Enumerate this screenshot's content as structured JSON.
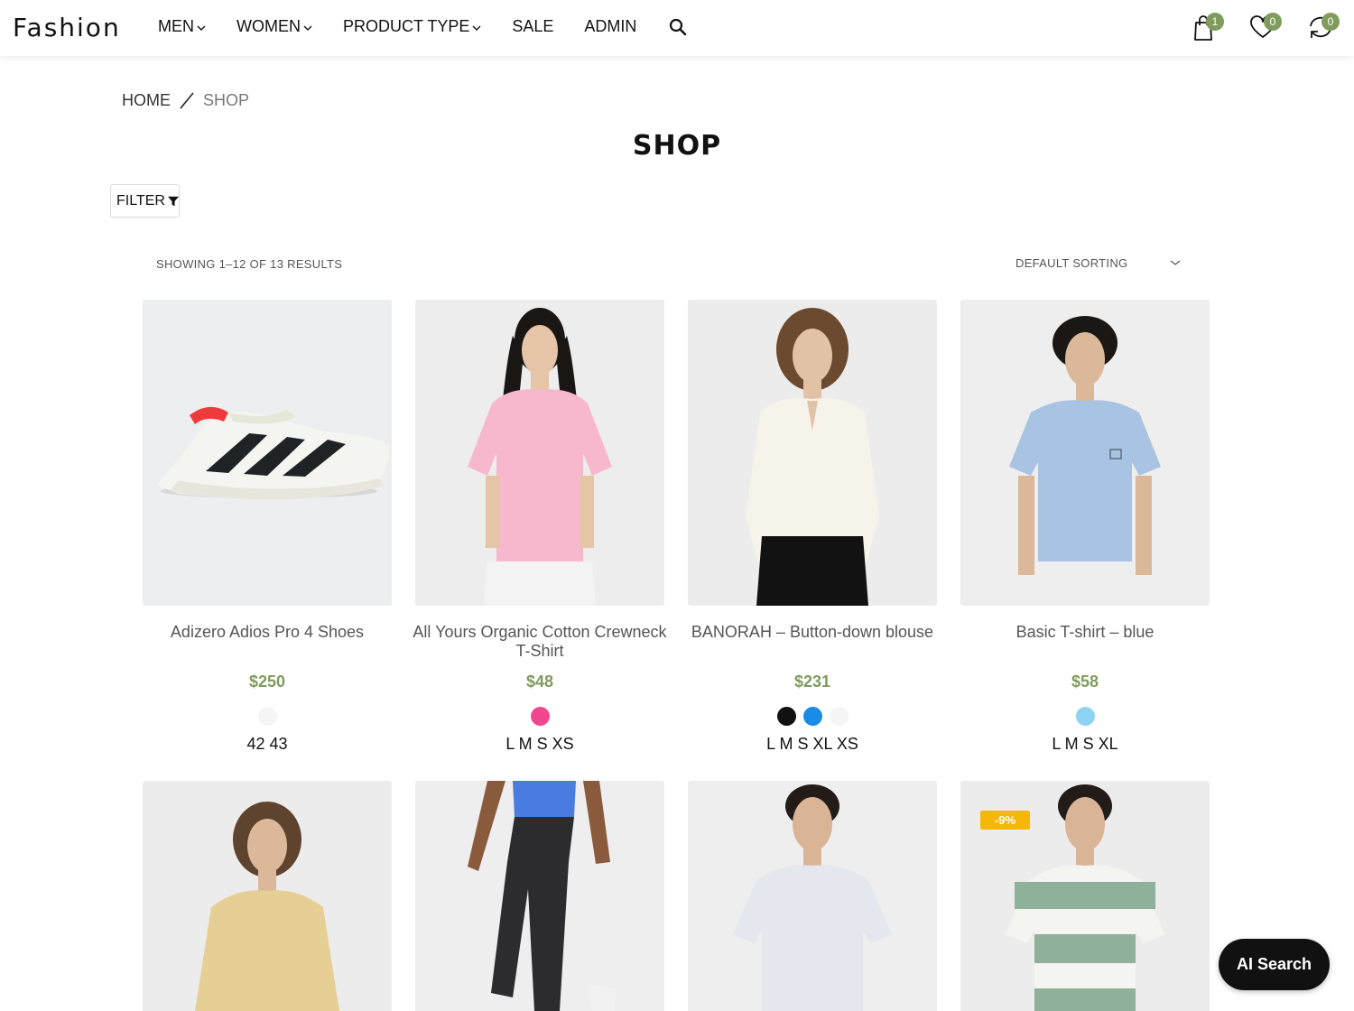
{
  "header": {
    "logo": "Fashion",
    "nav": [
      {
        "label": "MEN",
        "dropdown": true
      },
      {
        "label": "WOMEN",
        "dropdown": true
      },
      {
        "label": "PRODUCT TYPE",
        "dropdown": true
      },
      {
        "label": "SALE",
        "dropdown": false
      },
      {
        "label": "ADMIN",
        "dropdown": false
      }
    ],
    "cart_count": "1",
    "wishlist_count": "0",
    "compare_count": "0",
    "badge_color": "#7f9c5d"
  },
  "breadcrumb": {
    "home": "HOME",
    "current": "SHOP"
  },
  "page_title": "SHOP",
  "filter_label": "FILTER",
  "result_count": "SHOWING 1–12 OF 13 RESULTS",
  "sorting": "DEFAULT SORTING",
  "products": [
    {
      "name": "Adizero Adios Pro 4 Shoes",
      "price": "$250",
      "swatches": [
        "#f5f5f5"
      ],
      "sizes": "42 43",
      "image": "sneaker"
    },
    {
      "name": "All Yours Organic Cotton Crewneck T-Shirt",
      "price": "$48",
      "swatches": [
        "#f2478e"
      ],
      "sizes": "L M S XS",
      "image": "pink-tshirt-woman"
    },
    {
      "name": "BANORAH – Button-down blouse",
      "price": "$231",
      "swatches": [
        "#111111",
        "#1c8be6",
        "#f5f5f5"
      ],
      "sizes": "L M S XL XS",
      "image": "white-blouse-woman"
    },
    {
      "name": "Basic T-shirt – blue",
      "price": "$58",
      "swatches": [
        "#8fd3f4"
      ],
      "sizes": "L M S XL",
      "image": "blue-tshirt-man"
    },
    {
      "name": "",
      "price": "",
      "image": "yellow-blouse-woman"
    },
    {
      "name": "",
      "price": "",
      "image": "black-joggers"
    },
    {
      "name": "",
      "price": "",
      "image": "white-tshirt-man"
    },
    {
      "name": "",
      "price": "",
      "image": "striped-tshirt-man",
      "sale_badge": "-9%"
    }
  ],
  "price_color": "#7f9c5d",
  "ai_search_label": "AI Search"
}
